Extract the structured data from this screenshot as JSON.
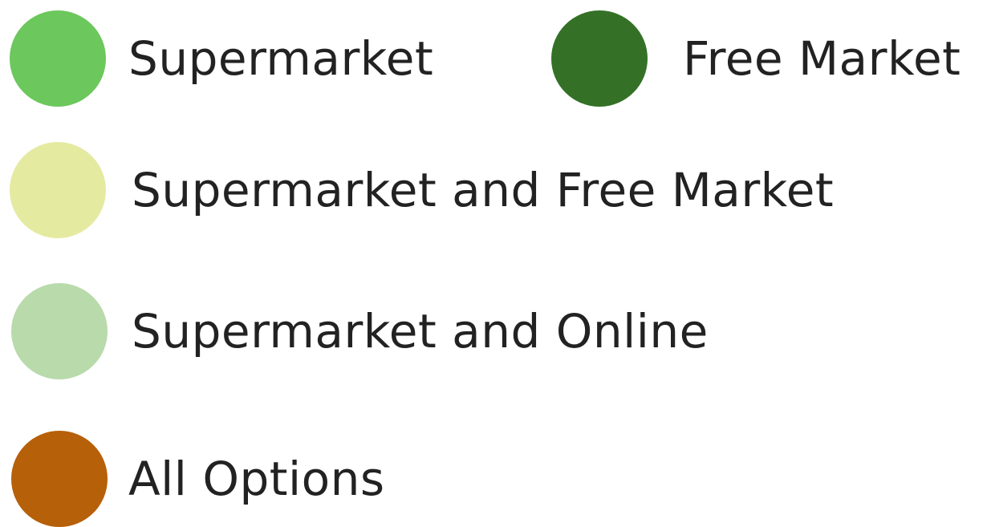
{
  "legend": {
    "items": [
      {
        "label": "Supermarket",
        "color": "#6CC75C"
      },
      {
        "label": "Free Market",
        "color": "#347127"
      },
      {
        "label": "Supermarket and Free Market",
        "color": "#E5EAA1"
      },
      {
        "label": "Supermarket and Online",
        "color": "#B9DAAB"
      },
      {
        "label": "All Options",
        "color": "#B6600A"
      }
    ]
  }
}
